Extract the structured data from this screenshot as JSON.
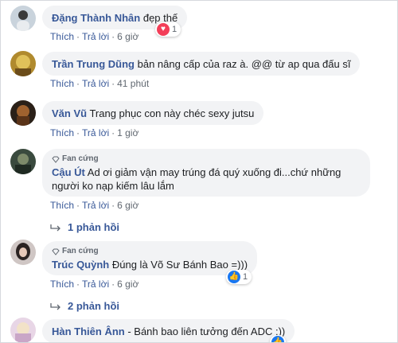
{
  "comments": [
    {
      "author": "Đặng Thành Nhân",
      "text": "đẹp thế",
      "like_label": "Thích",
      "reply_label": "Trả lời",
      "time": "6 giờ",
      "reaction": {
        "type": "love",
        "count": "1"
      }
    },
    {
      "author": "Trần Trung Dũng",
      "text": "bản nâng cấp của raz à. @@ từ ap qua đấu sĩ",
      "like_label": "Thích",
      "reply_label": "Trả lời",
      "time": "41 phút"
    },
    {
      "author": "Văn Vũ",
      "text": "Trang phục con này chéc sexy jutsu",
      "like_label": "Thích",
      "reply_label": "Trả lời",
      "time": "1 giờ"
    },
    {
      "badge": "Fan cứng",
      "author": "Cậu Út",
      "text_line1": "Ad ơi giảm vận may trúng đá quý xuống đi...chứ những",
      "text_line2": "người ko nạp kiếm lâu lắm",
      "like_label": "Thích",
      "reply_label": "Trả lời",
      "time": "6 giờ",
      "replies": "1 phản hồi"
    },
    {
      "badge": "Fan cứng",
      "author": "Trúc Quỳnh",
      "text": "Đúng là Võ Sư Bánh Bao =)))",
      "like_label": "Thích",
      "reply_label": "Trả lời",
      "time": "6 giờ",
      "reaction": {
        "type": "like",
        "count": "1"
      },
      "replies": "2 phản hồi"
    },
    {
      "author": "Hàn Thiên Ânn",
      "text": "- Bánh bao liên tưởng đến ADC :))"
    }
  ],
  "colors": {
    "name": "#385898",
    "bubble": "#f2f3f5",
    "meta": "#606770",
    "love": "#f33e58",
    "like": "#1877f2"
  },
  "icons": {
    "badge": "diamond-icon",
    "reply_arrow": "reply-arrow-icon",
    "love": "heart-icon",
    "like": "thumbs-up-icon"
  }
}
